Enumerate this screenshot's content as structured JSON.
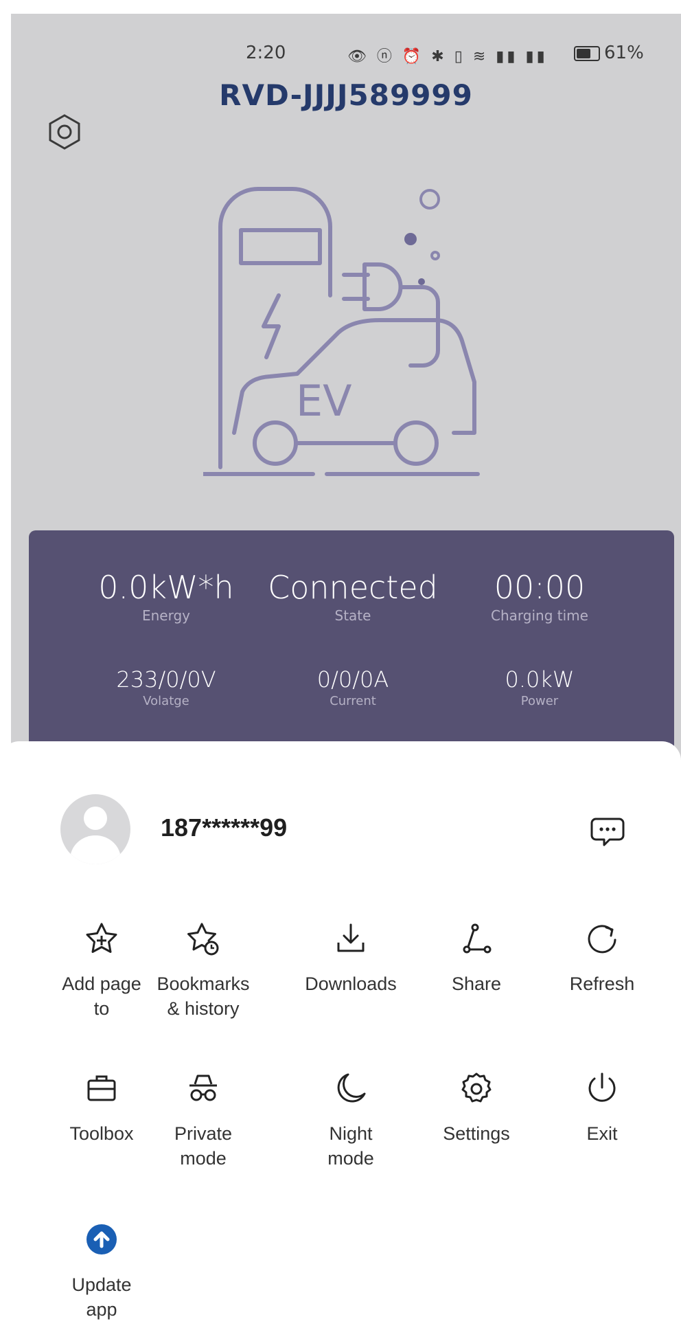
{
  "status_bar": {
    "time": "2:20",
    "icons": "👁 ⓝ ⏰ ✱ ▯ ≋ ▮▮ ▮▮",
    "battery": "61%"
  },
  "header": {
    "device_id": "RVD-JJJJ589999"
  },
  "illustration": {
    "label": "EV"
  },
  "stats": {
    "energy": {
      "value": "0.0kW*h",
      "label": "Energy"
    },
    "state": {
      "value": "Connected",
      "label": "State"
    },
    "charging_time": {
      "value": "00:00",
      "label": "Charging time"
    },
    "voltage": {
      "value": "233/0/0V",
      "label": "Volatge"
    },
    "current": {
      "value": "0/0/0A",
      "label": "Current"
    },
    "power": {
      "value": "0.0kW",
      "label": "Power"
    }
  },
  "account": {
    "phone": "187******99"
  },
  "menu": {
    "add_page_to": "Add page\nto",
    "bookmarks": "Bookmarks\n& history",
    "downloads": "Downloads",
    "share": "Share",
    "refresh": "Refresh",
    "toolbox": "Toolbox",
    "private_mode": "Private\nmode",
    "night_mode": "Night\nmode",
    "settings": "Settings",
    "exit": "Exit",
    "update_app": "Update\napp"
  },
  "colors": {
    "screen_bg": "#d0d0d2",
    "title": "#253a6b",
    "stats_panel": "#565172",
    "illustration_stroke": "#8a86ae",
    "update_accent": "#1a5fb4"
  }
}
